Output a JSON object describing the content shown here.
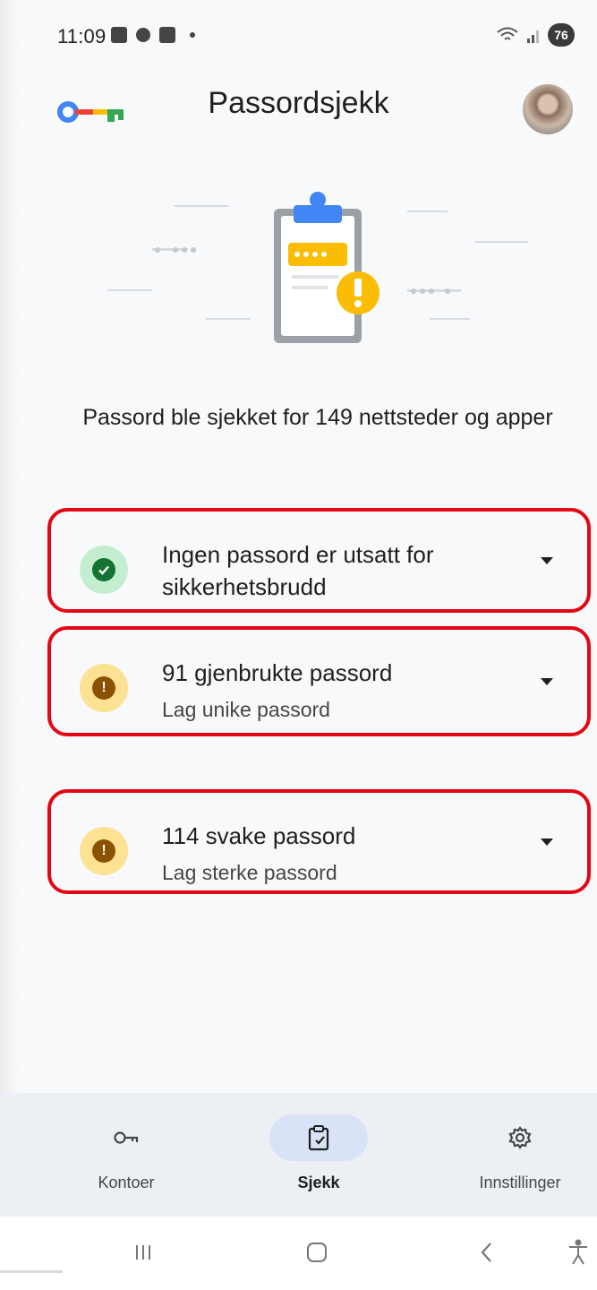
{
  "status_bar": {
    "time": "11:09",
    "battery": "76"
  },
  "app_bar": {
    "title": "Passordsjekk"
  },
  "summary": {
    "text": "Passord ble sjekket for 149 nettsteder og apper"
  },
  "results": [
    {
      "status": "ok",
      "title": "Ingen passord er utsatt for sikkerhetsbrudd",
      "subtitle": ""
    },
    {
      "status": "warning",
      "title": "91 gjenbrukte passord",
      "subtitle": "Lag unike passord"
    },
    {
      "status": "warning",
      "title": "114 svake passord",
      "subtitle": "Lag sterke passord"
    }
  ],
  "bottom_nav": {
    "items": [
      {
        "label": "Kontoer",
        "icon": "key-icon",
        "active": false
      },
      {
        "label": "Sjekk",
        "icon": "clipboard-check-icon",
        "active": true
      },
      {
        "label": "Innstillinger",
        "icon": "gear-icon",
        "active": false
      }
    ]
  },
  "system_nav": {
    "icons": [
      "recent-apps-icon",
      "home-icon",
      "back-icon",
      "accessibility-icon"
    ]
  },
  "colors": {
    "ok": "#137333",
    "warning": "#8a5200",
    "highlight_border": "#e30613",
    "active_nav": "#d9e3f7"
  }
}
